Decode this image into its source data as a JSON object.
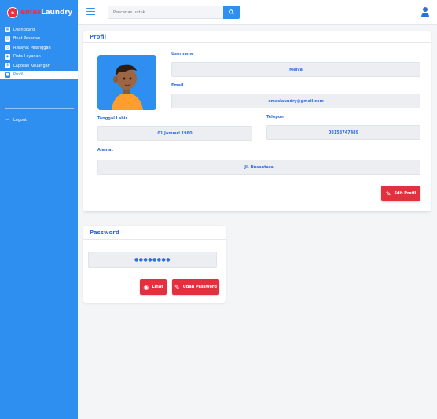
{
  "brand": {
    "name_part1": "emas",
    "name_part2": "Laundry",
    "logo_text": "e"
  },
  "sidebar": {
    "items": [
      {
        "label": "Dashboard",
        "icon": "dashboard-icon"
      },
      {
        "label": "Buat Pesanan",
        "icon": "order-icon"
      },
      {
        "label": "Riwayat Pelanggan",
        "icon": "history-icon"
      },
      {
        "label": "Data Layanan",
        "icon": "service-icon"
      },
      {
        "label": "Laporan Keuangan",
        "icon": "finance-icon"
      },
      {
        "label": "Profil",
        "icon": "user-icon"
      }
    ],
    "logout_label": "Logout"
  },
  "topbar": {
    "search_placeholder": "Pencarian untuk..."
  },
  "profile": {
    "title": "Profil",
    "username_label": "Username",
    "username_value": "Melva",
    "email_label": "Email",
    "email_value": "emaslaundry@gmail.com",
    "birthdate_label": "Tanggal Lahir",
    "birthdate_value": "01 Januari 1980",
    "phone_label": "Telepon",
    "phone_value": "08153747489",
    "address_label": "Alamat",
    "address_value": "Jl. Nusantara",
    "edit_button": "Edit Profil"
  },
  "password": {
    "title": "Password",
    "masked_value": "●●●●●●●●",
    "show_button": "Lihat",
    "change_button": "Ubah Password"
  },
  "colors": {
    "accent": "#2f8ff0",
    "danger": "#e3303e",
    "label": "#2f6ee0"
  }
}
